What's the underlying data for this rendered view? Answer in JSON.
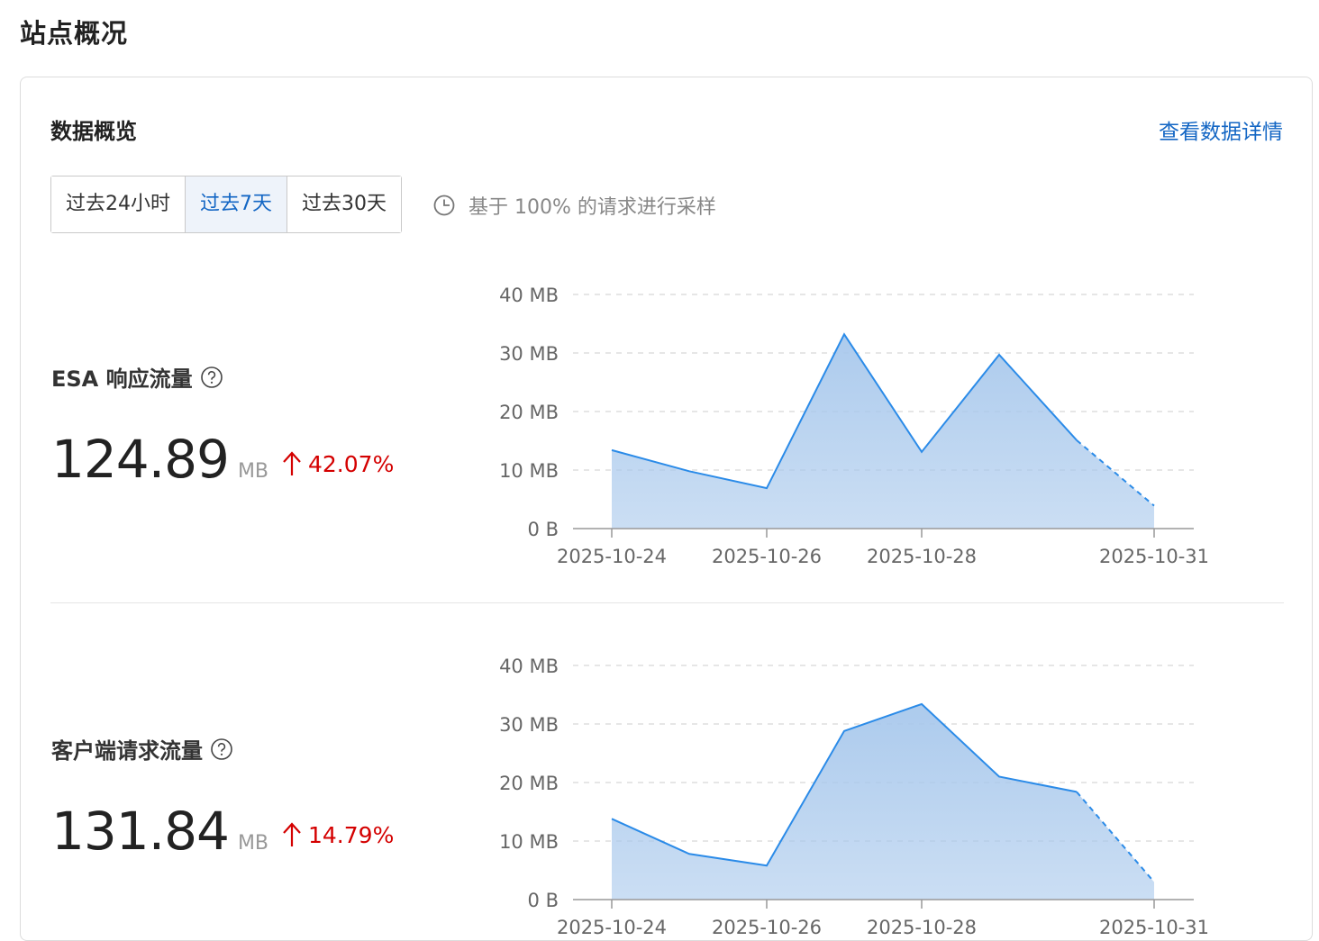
{
  "page_title": "站点概况",
  "card": {
    "title": "数据概览",
    "detail_link": "查看数据详情",
    "ranges": [
      "过去24小时",
      "过去7天",
      "过去30天"
    ],
    "active_range": 1,
    "sampling_text": "基于 100% 的请求进行采样"
  },
  "metrics": [
    {
      "label": "ESA 响应流量",
      "value": "124.89",
      "unit": "MB",
      "change": "42.07%"
    },
    {
      "label": "客户端请求流量",
      "value": "131.84",
      "unit": "MB",
      "change": "14.79%"
    }
  ],
  "colors": {
    "accent": "#1366c4",
    "up": "#d40000",
    "line": "#2b8be8",
    "area": "#a8c8ec"
  },
  "chart_data": [
    {
      "type": "area",
      "x": [
        "2025-10-24",
        "2025-10-25",
        "2025-10-26",
        "2025-10-27",
        "2025-10-28",
        "2025-10-29",
        "2025-10-30",
        "2025-10-31"
      ],
      "values": [
        13.4,
        9.8,
        6.9,
        33.2,
        13.1,
        29.7,
        15.1,
        3.9
      ],
      "x_tick_labels": [
        "2025-10-24",
        "2025-10-26",
        "2025-10-28",
        "2025-10-31"
      ],
      "y_tick_labels": [
        "0 B",
        "10 MB",
        "20 MB",
        "30 MB",
        "40 MB"
      ],
      "ylim": [
        0,
        40
      ],
      "dashed_last_segment": true,
      "grid": true
    },
    {
      "type": "area",
      "x": [
        "2025-10-24",
        "2025-10-25",
        "2025-10-26",
        "2025-10-27",
        "2025-10-28",
        "2025-10-29",
        "2025-10-30",
        "2025-10-31"
      ],
      "values": [
        13.8,
        7.8,
        5.8,
        28.8,
        33.4,
        21.0,
        18.4,
        3.0
      ],
      "x_tick_labels": [
        "2025-10-24",
        "2025-10-26",
        "2025-10-28",
        "2025-10-31"
      ],
      "y_tick_labels": [
        "0 B",
        "10 MB",
        "20 MB",
        "30 MB",
        "40 MB"
      ],
      "ylim": [
        0,
        40
      ],
      "dashed_last_segment": true,
      "grid": true
    }
  ]
}
